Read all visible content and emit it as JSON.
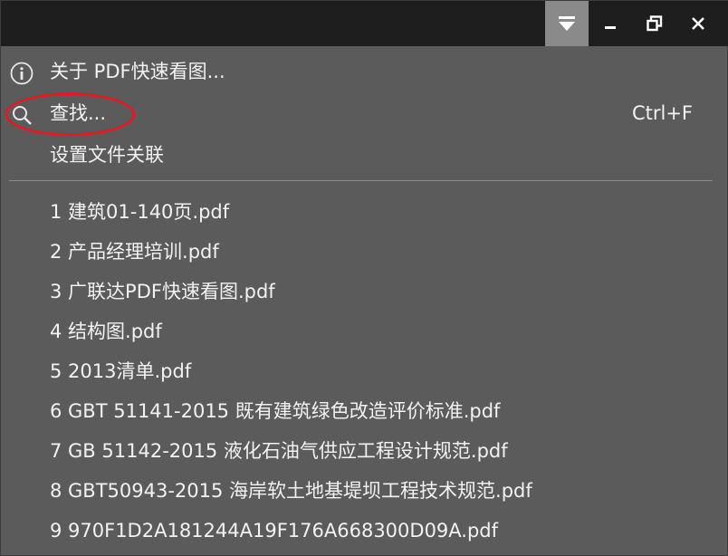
{
  "menu": {
    "about_label": "关于 PDF快速看图...",
    "find_label": "查找...",
    "find_shortcut": "Ctrl+F",
    "file_assoc_label": "设置文件关联"
  },
  "recent_files": [
    "1 建筑01-140页.pdf",
    "2 产品经理培训.pdf",
    "3 广联达PDF快速看图.pdf",
    "4 结构图.pdf",
    "5 2013清单.pdf",
    "6 GBT 51141-2015 既有建筑绿色改造评价标准.pdf",
    "7 GB 51142-2015 液化石油气供应工程设计规范.pdf",
    "8 GBT50943-2015 海岸软土地基堤坝工程技术规范.pdf",
    "9 970F1D2A181244A19F176A668300D09A.pdf"
  ],
  "icons": {
    "titlebar": [
      "menu-dropdown-icon",
      "minimize-icon",
      "restore-icon",
      "close-icon"
    ],
    "menu": [
      "info-icon",
      "search-icon"
    ]
  },
  "colors": {
    "menu_bg": "#5b5b5b",
    "titlebar_bg": "#1e1e1e",
    "active_titlebar_button": "#8a8a8a",
    "text": "#f2f2f2",
    "highlight_annotation": "#e01b24"
  }
}
